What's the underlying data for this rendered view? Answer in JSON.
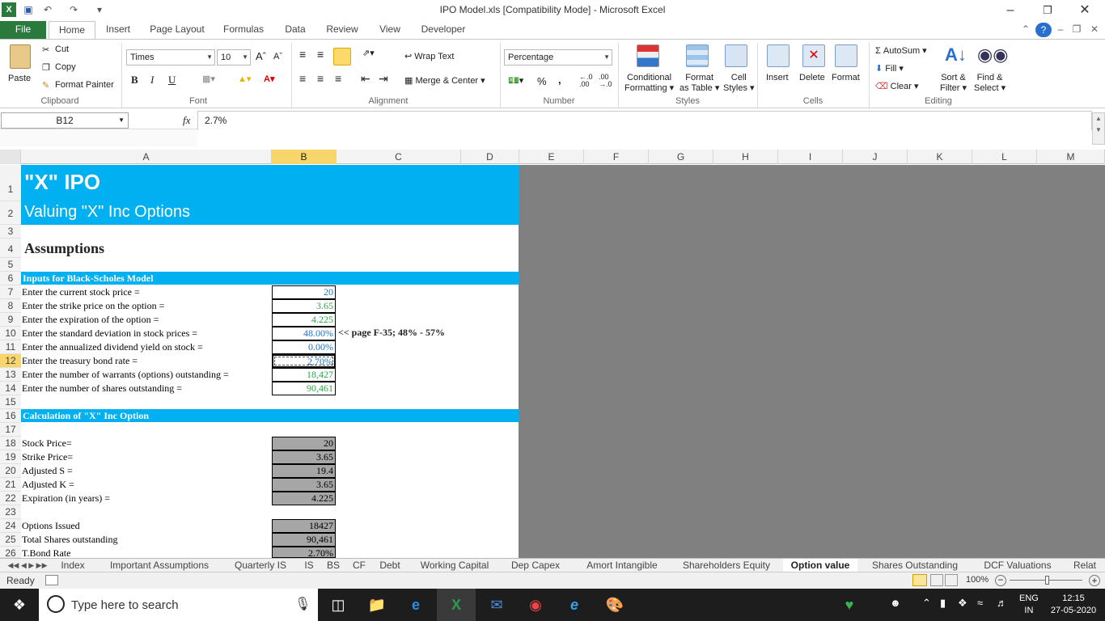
{
  "window": {
    "title": "IPO Model.xls  [Compatibility Mode]  -  Microsoft Excel"
  },
  "tabs": [
    {
      "label": "File"
    },
    {
      "label": "Home"
    },
    {
      "label": "Insert"
    },
    {
      "label": "Page Layout"
    },
    {
      "label": "Formulas"
    },
    {
      "label": "Data"
    },
    {
      "label": "Review"
    },
    {
      "label": "View"
    },
    {
      "label": "Developer"
    }
  ],
  "ribbon": {
    "clipboard": {
      "paste": "Paste",
      "cut": "Cut",
      "copy": "Copy",
      "format_painter": "Format Painter",
      "label": "Clipboard"
    },
    "font": {
      "name": "Times",
      "size": "10",
      "label": "Font",
      "bold": "B",
      "italic": "I",
      "underline": "U"
    },
    "alignment": {
      "wrap": "Wrap Text",
      "merge": "Merge & Center",
      "label": "Alignment"
    },
    "number": {
      "format": "Percentage",
      "pct": "%",
      "comma": ",",
      "label": "Number"
    },
    "styles": {
      "conditional": "Conditional",
      "conditional2": "Formatting",
      "format_table": "Format",
      "format_table2": "as Table",
      "cell_styles": "Cell",
      "cell_styles2": "Styles",
      "label": "Styles"
    },
    "cells": {
      "insert": "Insert",
      "delete": "Delete",
      "format": "Format",
      "label": "Cells"
    },
    "editing": {
      "autosum": "AutoSum",
      "fill": "Fill",
      "clear": "Clear",
      "sort": "Sort &",
      "sort2": "Filter",
      "find": "Find &",
      "find2": "Select",
      "label": "Editing"
    }
  },
  "formula_bar": {
    "name_box": "B12",
    "fx": "fx",
    "value": "2.7%"
  },
  "columns": [
    "A",
    "B",
    "C",
    "D",
    "E",
    "F",
    "G",
    "H",
    "I",
    "J",
    "K",
    "L",
    "M"
  ],
  "sheet": {
    "title": "\"X\" IPO",
    "subtitle": "Valuing \"X\" Inc Options",
    "assumptions": "Assumptions",
    "section1": "Inputs for Black-Scholes Model",
    "section2": "Calculation of \"X\" Inc Option",
    "note": "<< page F-35; 48% - 57%",
    "rows": [
      {
        "r": 1,
        "a": "",
        "b": ""
      },
      {
        "r": 7,
        "a": "Enter the current stock price =",
        "b": "20",
        "color": "blue"
      },
      {
        "r": 8,
        "a": "Enter the strike price on the option =",
        "b": "3.65",
        "color": "green"
      },
      {
        "r": 9,
        "a": "Enter the expiration of the option =",
        "b": "4.225",
        "color": "green"
      },
      {
        "r": 10,
        "a": "Enter the standard deviation in stock prices =",
        "b": "48.00%",
        "color": "blue"
      },
      {
        "r": 11,
        "a": "Enter the annualized dividend yield on stock =",
        "b": "0.00%",
        "color": "blue"
      },
      {
        "r": 12,
        "a": "Enter the treasury bond rate =",
        "b": "2.70%",
        "color": "blue"
      },
      {
        "r": 13,
        "a": "Enter the number of warrants (options) outstanding =",
        "b": "18,427",
        "color": "green"
      },
      {
        "r": 14,
        "a": "Enter the number of shares outstanding =",
        "b": "90,461",
        "color": "green"
      },
      {
        "r": 18,
        "a": "Stock Price=",
        "b": "20"
      },
      {
        "r": 19,
        "a": "Strike Price=",
        "b": "3.65"
      },
      {
        "r": 20,
        "a": "Adjusted S =",
        "b": "19.4"
      },
      {
        "r": 21,
        "a": "Adjusted K =",
        "b": "3.65"
      },
      {
        "r": 22,
        "a": "Expiration (in years) =",
        "b": "4.225"
      },
      {
        "r": 24,
        "a": "Options Issued",
        "b": "18427"
      },
      {
        "r": 25,
        "a": "Total Shares outstanding",
        "b": "90,461"
      },
      {
        "r": 26,
        "a": "T.Bond Rate",
        "b": "2.70%"
      }
    ]
  },
  "sheet_tabs": [
    "Index",
    "Important Assumptions",
    "Quarterly IS",
    "IS",
    "BS",
    "CF",
    "Debt",
    "Working Capital",
    "Dep Capex",
    "Amort Intangible",
    "Shareholders Equity",
    "Option value",
    "Shares Outstanding",
    "DCF Valuations",
    "Relat"
  ],
  "active_sheet": "Option value",
  "status": {
    "ready": "Ready",
    "zoom": "100%"
  },
  "taskbar": {
    "search": "Type here to search",
    "lang1": "ENG",
    "lang2": "IN",
    "time": "12:15",
    "date": "27-05-2020"
  }
}
